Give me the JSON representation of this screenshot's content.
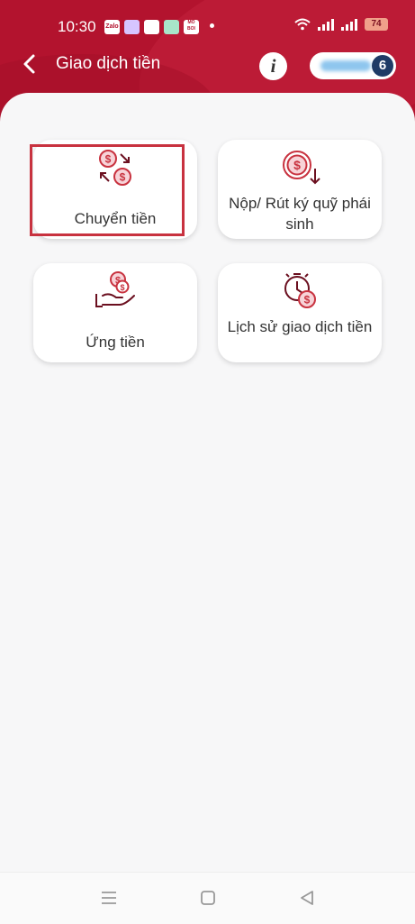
{
  "status_bar": {
    "time": "10:30",
    "app_icons": [
      "Zalo",
      "",
      "",
      "",
      "MO\nBOI"
    ],
    "battery": "74"
  },
  "header": {
    "title": "Giao dịch tiền",
    "info_label": "i",
    "account_count": "6"
  },
  "menu": [
    {
      "label": "Chuyển tiền",
      "icon": "money-transfer-icon"
    },
    {
      "label": "Nộp/ Rút ký quỹ phái sinh",
      "icon": "deposit-withdraw-icon"
    },
    {
      "label": "Ứng tiền",
      "icon": "cash-advance-icon"
    },
    {
      "label": "Lịch sử giao dịch tiền",
      "icon": "transaction-history-icon"
    }
  ],
  "colors": {
    "brand": "#b3132e",
    "icon": "#c8323f",
    "highlight": "#c8323f",
    "badge": "#1f3b66"
  }
}
